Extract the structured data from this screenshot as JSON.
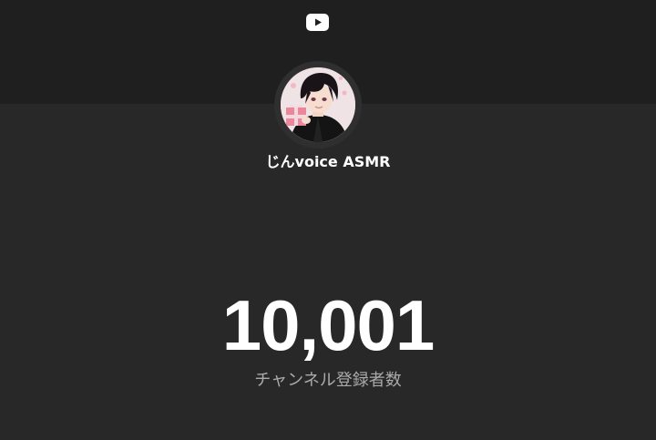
{
  "header": {
    "logo_icon": "youtube-play-icon",
    "logo_color": "#ffffff"
  },
  "channel": {
    "name": "じんvoice ASMR",
    "avatar_icon": "channel-avatar"
  },
  "stats": {
    "subscriber_count": "10,001",
    "subscriber_label": "チャンネル登録者数"
  },
  "colors": {
    "top_band": "#1f1f1f",
    "background": "#282828",
    "count_text": "#ffffff",
    "label_text": "#aaaaaa"
  }
}
